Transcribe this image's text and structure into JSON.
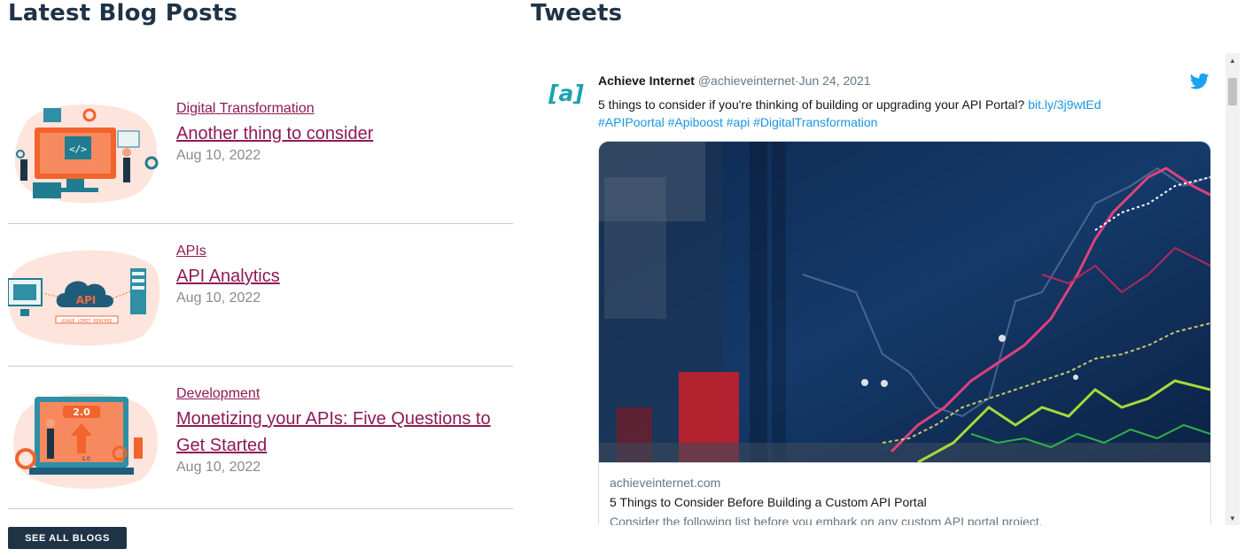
{
  "blog": {
    "heading": "Latest Blog Posts",
    "posts": [
      {
        "category": "Digital Transformation",
        "title": "Another thing to consider",
        "date": "Aug 10, 2022",
        "image_icon": "coding-illustration"
      },
      {
        "category": "APIs",
        "title": "API Analytics",
        "date": "Aug 10, 2022",
        "image_icon": "api-cloud-illustration",
        "image_text": "API",
        "image_caption": "USAGE_LIMIT_REACHED"
      },
      {
        "category": "Development",
        "title": "Monetizing your APIs: Five Questions to Get Started",
        "date": "Aug 10, 2022",
        "image_icon": "version-upgrade-illustration",
        "image_version": "2.0",
        "image_old_version": "1.0"
      }
    ],
    "see_all_label": "SEE ALL BLOGS"
  },
  "tweets": {
    "heading": "Tweets",
    "tweet": {
      "avatar_text": "[a]",
      "name": "Achieve Internet",
      "handle": "@achieveinternet",
      "separator": "·",
      "date": "Jun 24, 2021",
      "text": "5 things to consider if you're thinking of building or upgrading your API Portal?",
      "link": "bit.ly/3j9wtEd",
      "hashtags": "#APIPoortal #Apiboost #api #DigitalTransformation",
      "card": {
        "domain": "achieveinternet.com",
        "title": "5 Things to Consider Before Building a Custom API Portal",
        "description": "Consider the following list before you embark on any custom API portal project."
      }
    }
  },
  "colors": {
    "heading": "#1f3347",
    "blog_link": "#8e1a56",
    "date": "#8a8a8a",
    "button_bg": "#1f3347",
    "twitter_blue": "#1da1f2",
    "tweet_link": "#1b95e0",
    "avatar_teal": "#1ba1b0",
    "avatar_orange": "#f26a3d"
  }
}
